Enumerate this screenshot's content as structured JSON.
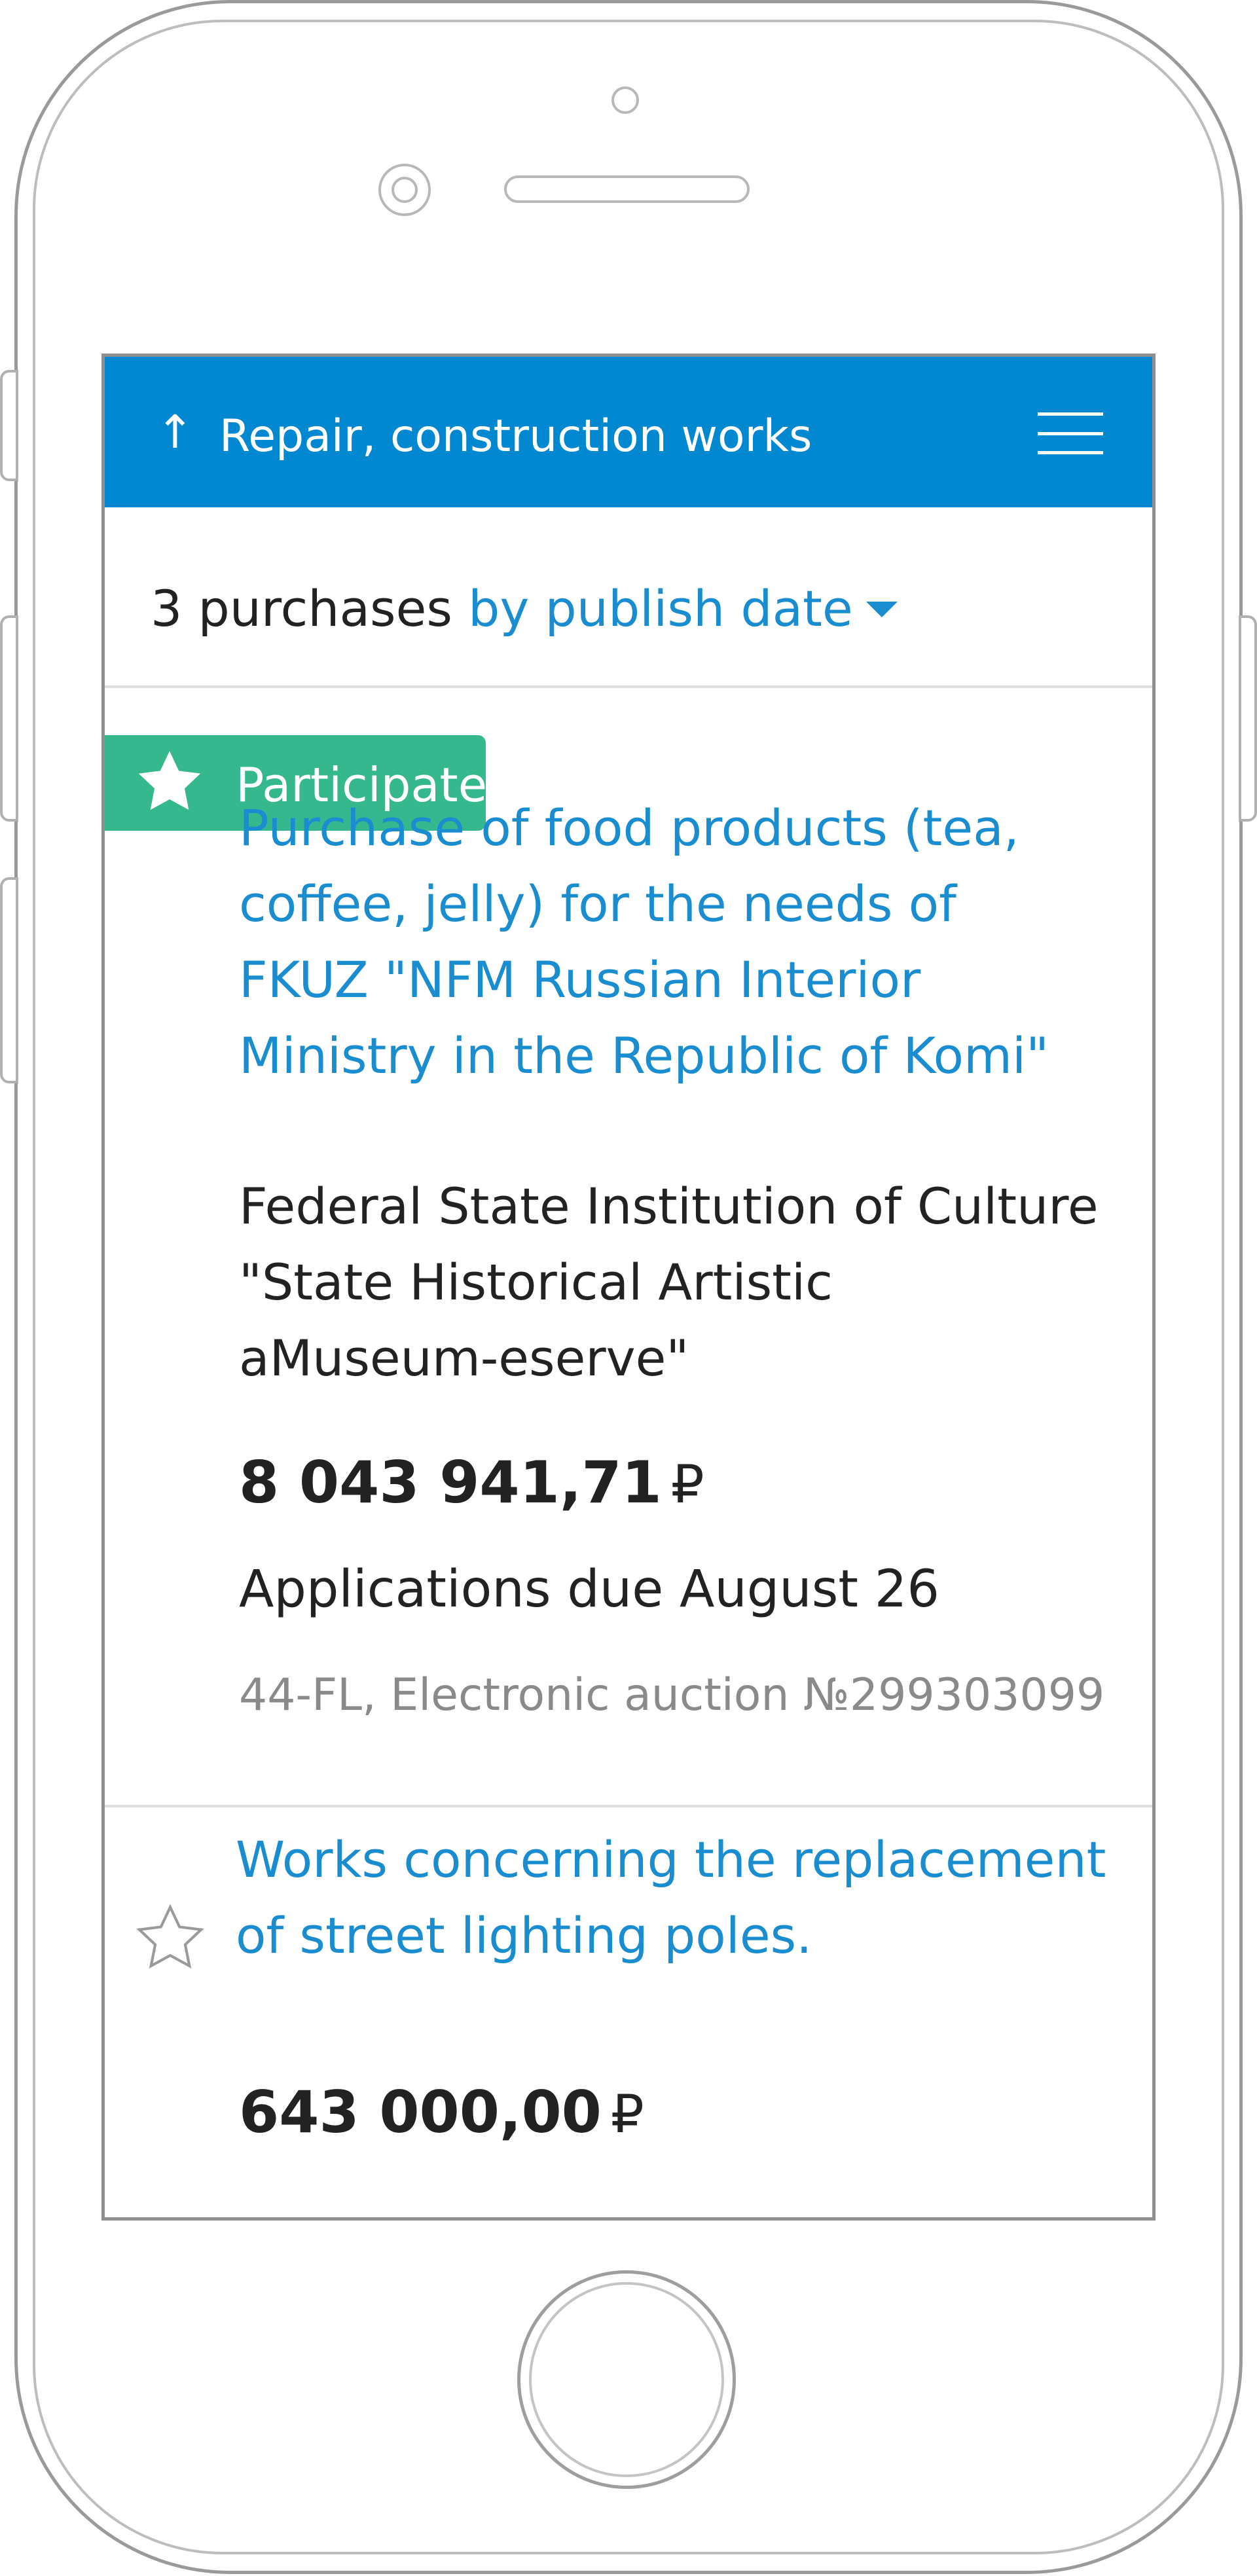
{
  "header": {
    "title": "Repair, construction works",
    "back_icon": "up-arrow-icon",
    "menu_icon": "hamburger-menu-icon",
    "color": "#0288d1"
  },
  "sort": {
    "count_text": "3 purchases",
    "sort_label": "by publish date",
    "caret_icon": "caret-down-icon"
  },
  "purchases": [
    {
      "badge": "Participate",
      "badge_color": "#35b88e",
      "title": "Purchase of food products (tea, coffee, jelly) for the needs of FKUZ \"NFM Russian Interior Ministry in the Republic of Komi\"",
      "customer": "Federal State Institution of Culture \"State Historical Artistic aMuseum-eserve\"",
      "price": "8 043 941,71",
      "currency": "₽",
      "due": "Applications due August 26",
      "meta": "44-FL, Electronic auction №299303099"
    },
    {
      "title": "Works concerning the replacement of street lighting poles.",
      "price": "643 000,00",
      "currency": "₽",
      "favorite_icon": "star-outline-icon"
    }
  ],
  "colors": {
    "link": "#1a8dd0",
    "text": "#222222",
    "muted": "#8a8a8a"
  }
}
